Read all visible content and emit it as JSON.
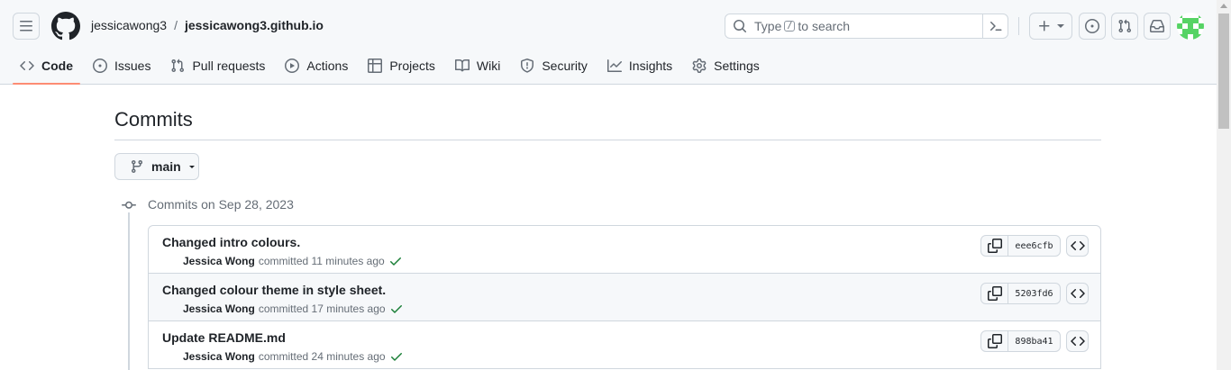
{
  "header": {
    "owner": "jessicawong3",
    "separator": "/",
    "repo": "jessicawong3.github.io",
    "search": {
      "before": "Type",
      "key": "/",
      "after": "to search"
    }
  },
  "tabs": [
    {
      "label": "Code",
      "icon": "code-icon",
      "active": true
    },
    {
      "label": "Issues",
      "icon": "issue-icon"
    },
    {
      "label": "Pull requests",
      "icon": "pull-request-icon"
    },
    {
      "label": "Actions",
      "icon": "play-icon"
    },
    {
      "label": "Projects",
      "icon": "table-icon"
    },
    {
      "label": "Wiki",
      "icon": "book-icon"
    },
    {
      "label": "Security",
      "icon": "shield-icon"
    },
    {
      "label": "Insights",
      "icon": "graph-icon"
    },
    {
      "label": "Settings",
      "icon": "gear-icon"
    }
  ],
  "main": {
    "title": "Commits",
    "branch": "main",
    "group_label": "Commits on Sep 28, 2023",
    "commits": [
      {
        "message": "Changed intro colours.",
        "author": "Jessica Wong",
        "verb": "committed",
        "time": "11 minutes ago",
        "sha": "eee6cfb"
      },
      {
        "message": "Changed colour theme in style sheet.",
        "author": "Jessica Wong",
        "verb": "committed",
        "time": "17 minutes ago",
        "sha": "5203fd6"
      },
      {
        "message": "Update README.md",
        "author": "Jessica Wong",
        "verb": "committed",
        "time": "24 minutes ago",
        "sha": "898ba41"
      }
    ]
  },
  "colors": {
    "accent_underline": "#fd8c73",
    "success": "#1a7f37",
    "avatar": "#56d364"
  }
}
